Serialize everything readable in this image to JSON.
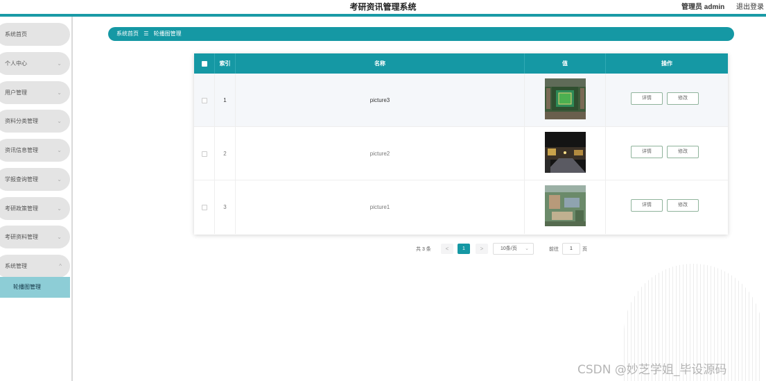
{
  "header": {
    "title": "考研资讯管理系统",
    "admin_label": "管理员 admin",
    "logout_label": "退出登录"
  },
  "sidebar": {
    "items": [
      {
        "label": "系统首页",
        "has_chevron": false
      },
      {
        "label": "个人中心",
        "has_chevron": true
      },
      {
        "label": "用户管理",
        "has_chevron": true
      },
      {
        "label": "资料分类管理",
        "has_chevron": true
      },
      {
        "label": "资讯信息管理",
        "has_chevron": true
      },
      {
        "label": "学报查询管理",
        "has_chevron": true
      },
      {
        "label": "考研政策管理",
        "has_chevron": true
      },
      {
        "label": "考研资料管理",
        "has_chevron": true
      },
      {
        "label": "系统管理",
        "has_chevron": true,
        "expanded": true
      }
    ],
    "active_sub": "轮播图管理"
  },
  "breadcrumb": {
    "home": "系统首页",
    "separator": "☰",
    "current": "轮播图管理"
  },
  "table": {
    "headers": {
      "index": "索引",
      "name": "名称",
      "value": "值",
      "actions": "操作"
    },
    "rows": [
      {
        "index": "1",
        "name": "picture3",
        "image": "aerial-stadium-photo"
      },
      {
        "index": "2",
        "name": "picture2",
        "image": "night-campus-road-photo"
      },
      {
        "index": "3",
        "name": "picture1",
        "image": "aerial-campus-buildings-photo"
      }
    ],
    "detail_label": "详情",
    "edit_label": "修改"
  },
  "pagination": {
    "total": "共 3 条",
    "prev": "<",
    "current_page": "1",
    "next": ">",
    "page_size": "10条/页",
    "goto_label": "前往",
    "goto_value": "1",
    "page_suffix": "页"
  },
  "watermark": "CSDN @妙芝学姐_毕设源码",
  "colors": {
    "accent": "#1598a4",
    "sidebar_item": "#e4e4e4",
    "sidebar_active": "#8dcdd6"
  }
}
